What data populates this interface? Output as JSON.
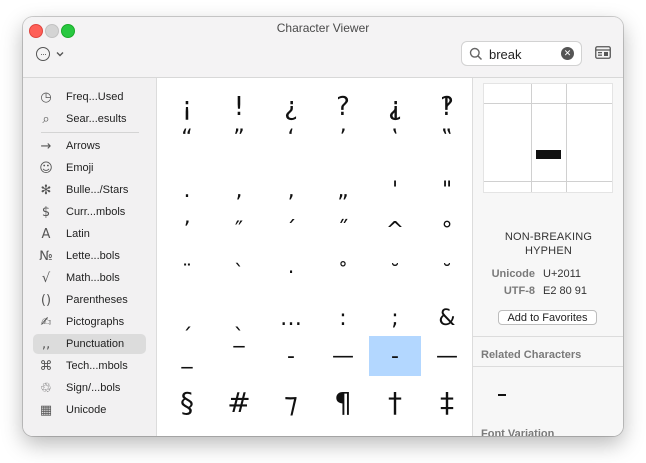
{
  "window": {
    "title": "Character Viewer"
  },
  "toolbar": {
    "search_value": "break",
    "search_placeholder": "Search",
    "action_glyph": "···",
    "clear_glyph": "✕"
  },
  "sidebar": {
    "items": [
      {
        "label": "Freq...Used",
        "icon": "◷"
      },
      {
        "label": "Sear...esults",
        "icon": "⌕"
      },
      {
        "label": "Arrows",
        "icon": "→"
      },
      {
        "label": "Emoji",
        "icon": "☺"
      },
      {
        "label": "Bulle.../Stars",
        "icon": "✻"
      },
      {
        "label": "Curr...mbols",
        "icon": "$"
      },
      {
        "label": "Latin",
        "icon": "A"
      },
      {
        "label": "Lette...bols",
        "icon": "№"
      },
      {
        "label": "Math...bols",
        "icon": "√"
      },
      {
        "label": "Parentheses",
        "icon": "()"
      },
      {
        "label": "Pictographs",
        "icon": "✍"
      },
      {
        "label": "Punctuation",
        "icon": "‚‚"
      },
      {
        "label": "Tech...mbols",
        "icon": "⌘"
      },
      {
        "label": "Sign/...bols",
        "icon": "♲"
      },
      {
        "label": "Unicode",
        "icon": "▦"
      }
    ],
    "selected_label": "Punctuation"
  },
  "grid": {
    "rows": [
      [
        "¡",
        "!",
        "¿",
        "?",
        "⸘",
        "‽"
      ],
      [
        "“",
        "”",
        "‘",
        "’",
        "‛",
        "‟"
      ],
      [
        ".",
        ",",
        "‚",
        "„",
        "'",
        "\""
      ],
      [
        "’",
        "″",
        "´",
        "˝",
        "^",
        "°"
      ],
      [
        "¨",
        "`",
        "·",
        "˚",
        "˘",
        "˘"
      ],
      [
        "ˏ",
        "ˎ",
        "…",
        ":",
        ";",
        "&"
      ],
      [
        "_",
        "‾",
        "-",
        "—",
        "-",
        "—"
      ],
      [
        "§",
        "#",
        "⁊",
        "¶",
        "†",
        "‡"
      ]
    ],
    "selected": "-"
  },
  "detail": {
    "name_line1": "NON-BREAKING",
    "name_line2": "HYPHEN",
    "unicode_label": "Unicode",
    "unicode_value": "U+2011",
    "utf8_label": "UTF-8",
    "utf8_value": "E2 80 91",
    "add_favorites_label": "Add to Favorites",
    "related_heading": "Related Characters",
    "related_char": "-",
    "font_variation_heading": "Font Variation"
  }
}
